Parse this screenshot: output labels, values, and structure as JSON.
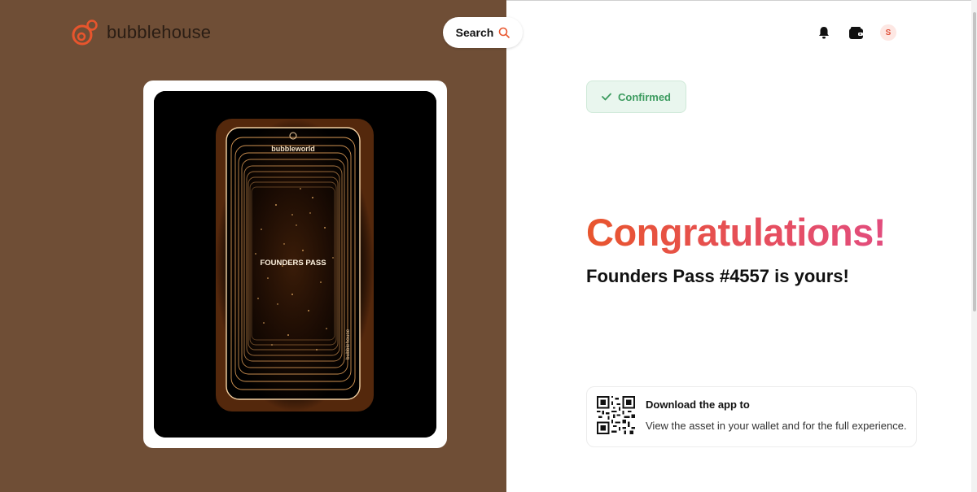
{
  "header": {
    "brand": "bubblehouse",
    "search_label": "Search",
    "avatar_initial": "S"
  },
  "nft": {
    "art_brand": "bubbleworld",
    "art_title": "FOUNDERS PASS",
    "art_side_label": "bubblehouse"
  },
  "status": {
    "badge": "Confirmed"
  },
  "main": {
    "heading": "Congratulations!",
    "subheading": "Founders Pass #4557 is yours!"
  },
  "download": {
    "title": "Download the app to",
    "text": "View the asset in your wallet and for the full experience."
  },
  "colors": {
    "left_bg": "#6f4e36",
    "accent_start": "#e8552d",
    "accent_end": "#e24d7e",
    "confirmed_green": "#3c9b5f"
  },
  "icons": [
    "bubblehouse-logo-icon",
    "search-icon",
    "bell-icon",
    "wallet-icon",
    "check-icon",
    "qr-code-icon"
  ]
}
